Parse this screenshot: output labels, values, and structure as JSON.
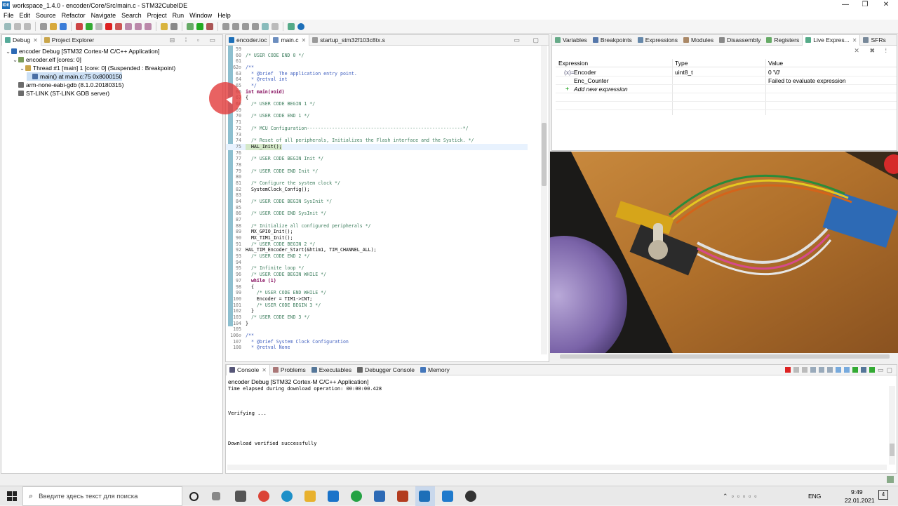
{
  "window": {
    "title": "workspace_1.4.0 - encoder/Core/Src/main.c - STM32CubeIDE",
    "app_icon_text": "IDE",
    "controls": [
      "—",
      "❐",
      "✕"
    ]
  },
  "menu": [
    "File",
    "Edit",
    "Source",
    "Refactor",
    "Navigate",
    "Search",
    "Project",
    "Run",
    "Window",
    "Help"
  ],
  "left_panel": {
    "tabs": [
      {
        "label": "Debug"
      },
      {
        "label": "Project Explorer"
      }
    ],
    "tree": [
      {
        "label": "encoder Debug [STM32 Cortex-M C/C++ Application]",
        "level": 0,
        "expand": "⌄"
      },
      {
        "label": "encoder.elf [cores: 0]",
        "level": 1,
        "expand": "⌄"
      },
      {
        "label": "Thread #1 [main] 1 [core: 0] (Suspended : Breakpoint)",
        "level": 2,
        "expand": "⌄"
      },
      {
        "label": "main() at main.c:75 0x8000150",
        "level": 3,
        "expand": ""
      },
      {
        "label": "arm-none-eabi-gdb (8.1.0.20180315)",
        "level": 1,
        "expand": ""
      },
      {
        "label": "ST-LINK (ST-LINK GDB server)",
        "level": 1,
        "expand": ""
      }
    ]
  },
  "editor": {
    "tabs": [
      {
        "label": "encoder.ioc"
      },
      {
        "label": "main.c"
      },
      {
        "label": "startup_stm32f103c8tx.s"
      }
    ],
    "lines": [
      {
        "n": "59",
        "t": "",
        "c": ""
      },
      {
        "n": "60",
        "t": "/* USER CODE END 0 */",
        "c": "cm"
      },
      {
        "n": "61",
        "t": "",
        "c": ""
      },
      {
        "n": "62⊖",
        "t": "/**",
        "c": "cmdoc"
      },
      {
        "n": "63",
        "t": "  * @brief  The application entry point.",
        "c": "cmdoc"
      },
      {
        "n": "64",
        "t": "  * @retval int",
        "c": "cmdoc"
      },
      {
        "n": "65",
        "t": "  */",
        "c": "cmdoc"
      },
      {
        "n": "66",
        "t": "int main(void)",
        "c": "kw"
      },
      {
        "n": "67",
        "t": "{",
        "c": ""
      },
      {
        "n": "68",
        "t": "  /* USER CODE BEGIN 1 */",
        "c": "cm"
      },
      {
        "n": "69",
        "t": "",
        "c": ""
      },
      {
        "n": "70",
        "t": "  /* USER CODE END 1 */",
        "c": "cm"
      },
      {
        "n": "71",
        "t": "",
        "c": ""
      },
      {
        "n": "72",
        "t": "  /* MCU Configuration--------------------------------------------------------*/",
        "c": "cm"
      },
      {
        "n": "73",
        "t": "",
        "c": ""
      },
      {
        "n": "74",
        "t": "  /* Reset of all peripherals, Initializes the Flash interface and the Systick. */",
        "c": "cm"
      },
      {
        "n": "75",
        "t": "  HAL_Init();",
        "c": "hl"
      },
      {
        "n": "76",
        "t": "",
        "c": ""
      },
      {
        "n": "77",
        "t": "  /* USER CODE BEGIN Init */",
        "c": "cm"
      },
      {
        "n": "78",
        "t": "",
        "c": ""
      },
      {
        "n": "79",
        "t": "  /* USER CODE END Init */",
        "c": "cm"
      },
      {
        "n": "80",
        "t": "",
        "c": ""
      },
      {
        "n": "81",
        "t": "  /* Configure the system clock */",
        "c": "cm"
      },
      {
        "n": "82",
        "t": "  SystemClock_Config();",
        "c": ""
      },
      {
        "n": "83",
        "t": "",
        "c": ""
      },
      {
        "n": "84",
        "t": "  /* USER CODE BEGIN SysInit */",
        "c": "cm"
      },
      {
        "n": "85",
        "t": "",
        "c": ""
      },
      {
        "n": "86",
        "t": "  /* USER CODE END SysInit */",
        "c": "cm"
      },
      {
        "n": "87",
        "t": "",
        "c": ""
      },
      {
        "n": "88",
        "t": "  /* Initialize all configured peripherals */",
        "c": "cm"
      },
      {
        "n": "89",
        "t": "  MX_GPIO_Init();",
        "c": ""
      },
      {
        "n": "90",
        "t": "  MX_TIM1_Init();",
        "c": ""
      },
      {
        "n": "91",
        "t": "  /* USER CODE BEGIN 2 */",
        "c": "cm"
      },
      {
        "n": "92",
        "t": "HAL_TIM_Encoder_Start(&htim1, TIM_CHANNEL_ALL);",
        "c": ""
      },
      {
        "n": "93",
        "t": "  /* USER CODE END 2 */",
        "c": "cm"
      },
      {
        "n": "94",
        "t": "",
        "c": ""
      },
      {
        "n": "95",
        "t": "  /* Infinite loop */",
        "c": "cm"
      },
      {
        "n": "96",
        "t": "  /* USER CODE BEGIN WHILE */",
        "c": "cm"
      },
      {
        "n": "97",
        "t": "  while (1)",
        "c": "kw"
      },
      {
        "n": "98",
        "t": "  {",
        "c": ""
      },
      {
        "n": "99",
        "t": "    /* USER CODE END WHILE */",
        "c": "cm"
      },
      {
        "n": "100",
        "t": "    Encoder = TIM1->CNT;",
        "c": ""
      },
      {
        "n": "101",
        "t": "    /* USER CODE BEGIN 3 */",
        "c": "cm"
      },
      {
        "n": "102",
        "t": "  }",
        "c": ""
      },
      {
        "n": "103",
        "t": "  /* USER CODE END 3 */",
        "c": "cm"
      },
      {
        "n": "104",
        "t": "}",
        "c": ""
      },
      {
        "n": "105",
        "t": "",
        "c": ""
      },
      {
        "n": "106⊖",
        "t": "/**",
        "c": "cmdoc"
      },
      {
        "n": "107",
        "t": "  * @brief System Clock Configuration",
        "c": "cmdoc"
      },
      {
        "n": "108",
        "t": "  * @retval None",
        "c": "cmdoc"
      }
    ]
  },
  "right_panel": {
    "tabs": [
      {
        "label": "Variables"
      },
      {
        "label": "Breakpoints"
      },
      {
        "label": "Expressions"
      },
      {
        "label": "Modules"
      },
      {
        "label": "Disassembly"
      },
      {
        "label": "Registers"
      },
      {
        "label": "Live Expres..."
      },
      {
        "label": "SFRs"
      }
    ],
    "columns": [
      "Expression",
      "Type",
      "Value"
    ],
    "rows": [
      {
        "expr": "Encoder",
        "type": "uint8_t",
        "value": "0 '\\0'",
        "icon": "(x)="
      },
      {
        "expr": "Enc_Counter",
        "type": "",
        "value": "Failed to evaluate expression",
        "icon": ""
      },
      {
        "expr": "Add new expression",
        "type": "",
        "value": "",
        "icon": "+"
      }
    ]
  },
  "console": {
    "tabs": [
      {
        "label": "Console"
      },
      {
        "label": "Problems"
      },
      {
        "label": "Executables"
      },
      {
        "label": "Debugger Console"
      },
      {
        "label": "Memory"
      }
    ],
    "header": "encoder Debug [STM32 Cortex-M C/C++ Application]",
    "lines": [
      "Time elapsed during download operation: 00:00:00.428",
      "",
      "",
      "",
      "Verifying ...",
      "",
      "",
      "",
      "",
      "Download verified successfully"
    ]
  },
  "taskbar": {
    "search_placeholder": "Введите здесь текст для поиска",
    "lang": "ENG",
    "time": "9:49",
    "date": "22.01.2021",
    "notifications": "4"
  },
  "colors": {
    "accent": "#1d6fb8",
    "highlight_line": "#e8f2fe",
    "cursor_circle": "#e23b3b"
  }
}
